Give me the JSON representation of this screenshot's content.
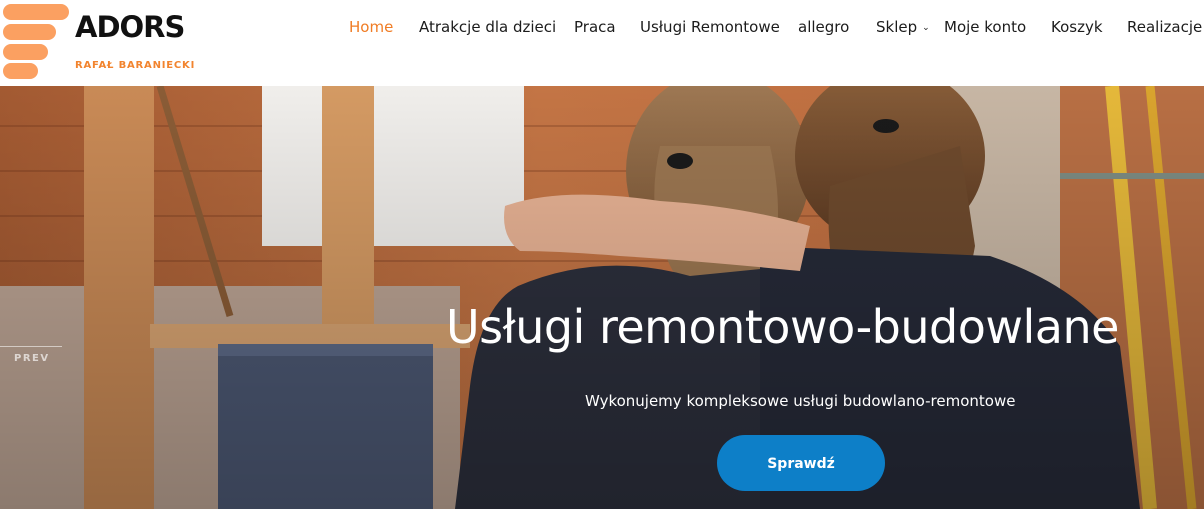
{
  "brand": {
    "name": "ADORS",
    "tagline": "RAFAŁ BARANIECKI",
    "accent_color": "#fba061"
  },
  "nav": {
    "items": [
      {
        "label": "Home",
        "active": true
      },
      {
        "label": "Atrakcje dla dzieci"
      },
      {
        "label": "Praca"
      },
      {
        "label": "Usługi Remontowe"
      },
      {
        "label": "allegro"
      },
      {
        "label": "Sklep",
        "has_dropdown": true,
        "icon": "chevron-down-icon"
      },
      {
        "label": "Moje konto"
      },
      {
        "label": "Koszyk"
      },
      {
        "label": "Realizacje"
      }
    ],
    "active_color": "#f07c24"
  },
  "hero": {
    "title": "Usługi remontowo-budowlane",
    "subtitle": "Wykonujemy kompleksowe usługi budowlano-remontowe",
    "cta_label": "Sprawdź",
    "cta_color": "#0d7fc8",
    "prev_label": "PREV"
  }
}
